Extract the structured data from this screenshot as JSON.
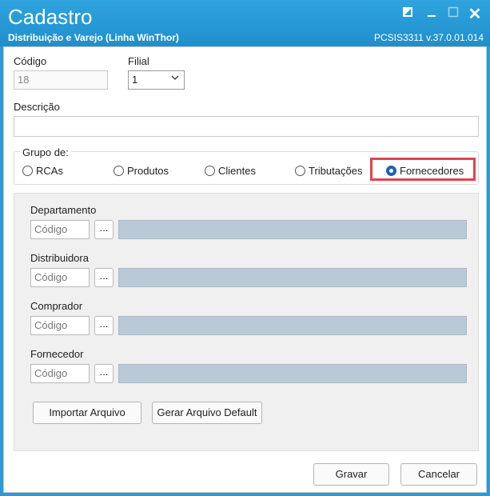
{
  "window": {
    "title": "Cadastro",
    "subtitle": "Distribuição e Varejo (Linha WinThor)",
    "version": "PCSIS3311  v.37.0.01.014",
    "controls": [
      "restore-icon",
      "minimize-icon",
      "maximize-icon",
      "close-icon"
    ]
  },
  "form": {
    "codigo_label": "Código",
    "codigo_value": "18",
    "filial_label": "Filial",
    "filial_value": "1",
    "descricao_label": "Descrição",
    "descricao_value": ""
  },
  "grupo": {
    "title": "Grupo de:",
    "options": [
      "RCAs",
      "Produtos",
      "Clientes",
      "Tributações",
      "Fornecedores"
    ],
    "selected": "Fornecedores"
  },
  "filters": [
    {
      "label": "Departamento",
      "placeholder": "Código",
      "button": "..."
    },
    {
      "label": "Distribuidora",
      "placeholder": "Código",
      "button": "..."
    },
    {
      "label": "Comprador",
      "placeholder": "Código",
      "button": "..."
    },
    {
      "label": "Fornecedor",
      "placeholder": "Código",
      "button": "..."
    }
  ],
  "actions": {
    "importar": "Importar Arquivo",
    "gerar": "Gerar Arquivo Default",
    "gravar": "Gravar",
    "cancelar": "Cancelar"
  },
  "colors": {
    "titlebar": "#2a9bd6",
    "highlight": "#e0444c",
    "radio_selected": "#1e5fb4"
  }
}
